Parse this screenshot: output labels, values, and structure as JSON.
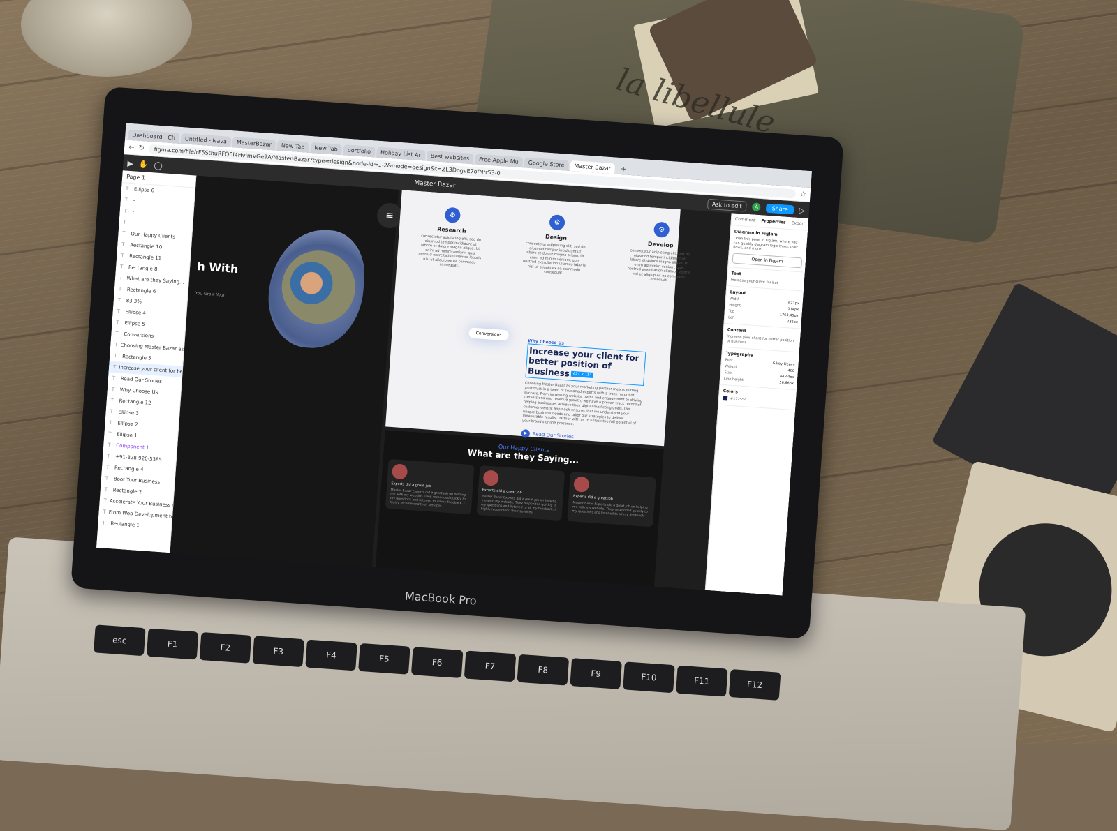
{
  "browser": {
    "tabs": [
      "Dashboard | Ch",
      "Untitled - Nava",
      "MasterBazar",
      "New Tab",
      "New Tab",
      "portfolio",
      "Holiday List Ar",
      "Best websites",
      "Free Apple Mu",
      "Google Store",
      "Master Bazar"
    ],
    "url": "figma.com/file/rF5SthuRFQ6I4HvImVGe9A/Master-Bazar?type=design&node-id=1-2&mode=design&t=ZL3DogvE7ofNfr53-0"
  },
  "figma": {
    "file_title": "Master Bazar",
    "ask_to_edit": "Ask to edit",
    "share": "Share",
    "avatar_initial": "A",
    "page": "Page 1",
    "layers": [
      {
        "label": "Ellipse 6"
      },
      {
        "label": "-"
      },
      {
        "label": "-"
      },
      {
        "label": "-"
      },
      {
        "label": "Our Happy Clients"
      },
      {
        "label": "Rectangle 10"
      },
      {
        "label": "Rectangle 11"
      },
      {
        "label": "Rectangle 8"
      },
      {
        "label": "What are they Saying..."
      },
      {
        "label": "Rectangle 6"
      },
      {
        "label": "83.3%"
      },
      {
        "label": "Ellipse 4"
      },
      {
        "label": "Ellipse 5"
      },
      {
        "label": "Conversions"
      },
      {
        "label": "Choosing Master Bazar as yo..."
      },
      {
        "label": "Rectangle 5"
      },
      {
        "label": "Increase your client for better..."
      },
      {
        "label": "Read Our Stories"
      },
      {
        "label": "Why Choose Us"
      },
      {
        "label": "Rectangle 12"
      },
      {
        "label": "Ellipse 3"
      },
      {
        "label": "Ellipse 2"
      },
      {
        "label": "Ellipse 1"
      },
      {
        "label": "Component 1"
      },
      {
        "label": "+91-828-920-5385"
      },
      {
        "label": "Rectangle 4"
      },
      {
        "label": "Boot Your Business"
      },
      {
        "label": "Rectangle 2"
      },
      {
        "label": "Accelerate Your Business Gro..."
      },
      {
        "label": "From Web Development to Di..."
      },
      {
        "label": "Rectangle 1"
      }
    ]
  },
  "canvas": {
    "hero_text": "h With",
    "hero_sub": "You Grow Your",
    "steps": [
      {
        "title": "Research",
        "desc": "consectetur adipiscing elit, sed do eiusmod tempor incididunt ut labore et dolore magna aliqua. Ut enim ad minim veniam, quis nostrud exercitation ullamco laboris nisi ut aliquip ex ea commodo consequat."
      },
      {
        "title": "Design",
        "desc": "consectetur adipiscing elit, sed do eiusmod tempor incididunt ut labore et dolore magna aliqua. Ut enim ad minim veniam, quis nostrud exercitation ullamco laboris nisi ut aliquip ex ea commodo consequat."
      },
      {
        "title": "Develop",
        "desc": "consectetur adipiscing elit, sed do eiusmod tempor incididunt ut labore et dolore magna aliqua. Ut enim ad minim veniam, quis nostrud exercitation ullamco laboris nisi ut aliquip ex ea commodo consequat."
      }
    ],
    "conversions": "Conversions",
    "why_tag": "Why Choose Us",
    "why_heading": "Increase your client for better position of Business",
    "why_body": "Choosing Master Bazar as your marketing partner means putting your trust in a team of seasoned experts with a track record of success. From increasing website traffic and engagement to driving conversions and revenue growth, we have a proven track record of helping businesses achieve their digital marketing goals. Our customer-centric approach ensures that we understand your unique business needs and tailor our strategies to deliver measurable results. Partner with us to unlock the full potential of your brand's online presence.",
    "dimension_badge": "621 × 114",
    "read_stories": "Read Our Stories",
    "clients_kicker": "Our Happy Clients",
    "clients_title": "What are they Saying...",
    "testimonials": [
      {
        "label": "Experts did a great job",
        "quote": "Master Bazar Experts did a great job on helping me with my website. They responded quickly to my questions and listened to all my feedback. I highly recommend their services."
      },
      {
        "label": "Experts did a great job",
        "quote": "Master Bazar Experts did a great job on helping me with my website. They responded quickly to my questions and listened to all my feedback. I highly recommend their services."
      },
      {
        "label": "Experts did a great job",
        "quote": "Master Bazar Experts did a great job on helping me with my website. They responded quickly to my questions and listened to all my feedback."
      }
    ]
  },
  "properties": {
    "tabs": [
      "Comment",
      "Properties",
      "Export"
    ],
    "diagram_title": "Diagram in FigJam",
    "diagram_desc": "Open this page in FigJam, where you can quickly diagram logic trees, user flows, and more.",
    "open_figjam": "Open in FigJam",
    "text_label": "Text",
    "text_preview": "Increase your client for bet",
    "layout_title": "Layout",
    "layout": [
      {
        "k": "Width",
        "v": "621px"
      },
      {
        "k": "Height",
        "v": "114px"
      },
      {
        "k": "Top",
        "v": "1763.45px"
      },
      {
        "k": "Left",
        "v": "735px"
      }
    ],
    "content_title": "Content",
    "content_text": "Increase your client for better position of Business",
    "typography_title": "Typography",
    "typography": [
      {
        "k": "Font",
        "v": "Gilroy-Heavy"
      },
      {
        "k": "Weight",
        "v": "400"
      },
      {
        "k": "Size",
        "v": "44.44px"
      },
      {
        "k": "Line height",
        "v": "56.66px"
      }
    ],
    "colors_title": "Colors",
    "color_hex": "#172554"
  },
  "device": {
    "brand": "MacBook Pro",
    "keys": [
      "esc",
      "F1",
      "F2",
      "F3",
      "F4",
      "F5",
      "F6",
      "F7",
      "F8",
      "F9",
      "F10",
      "F11",
      "F12"
    ]
  },
  "scene": {
    "pouch_text": "la libellule"
  }
}
